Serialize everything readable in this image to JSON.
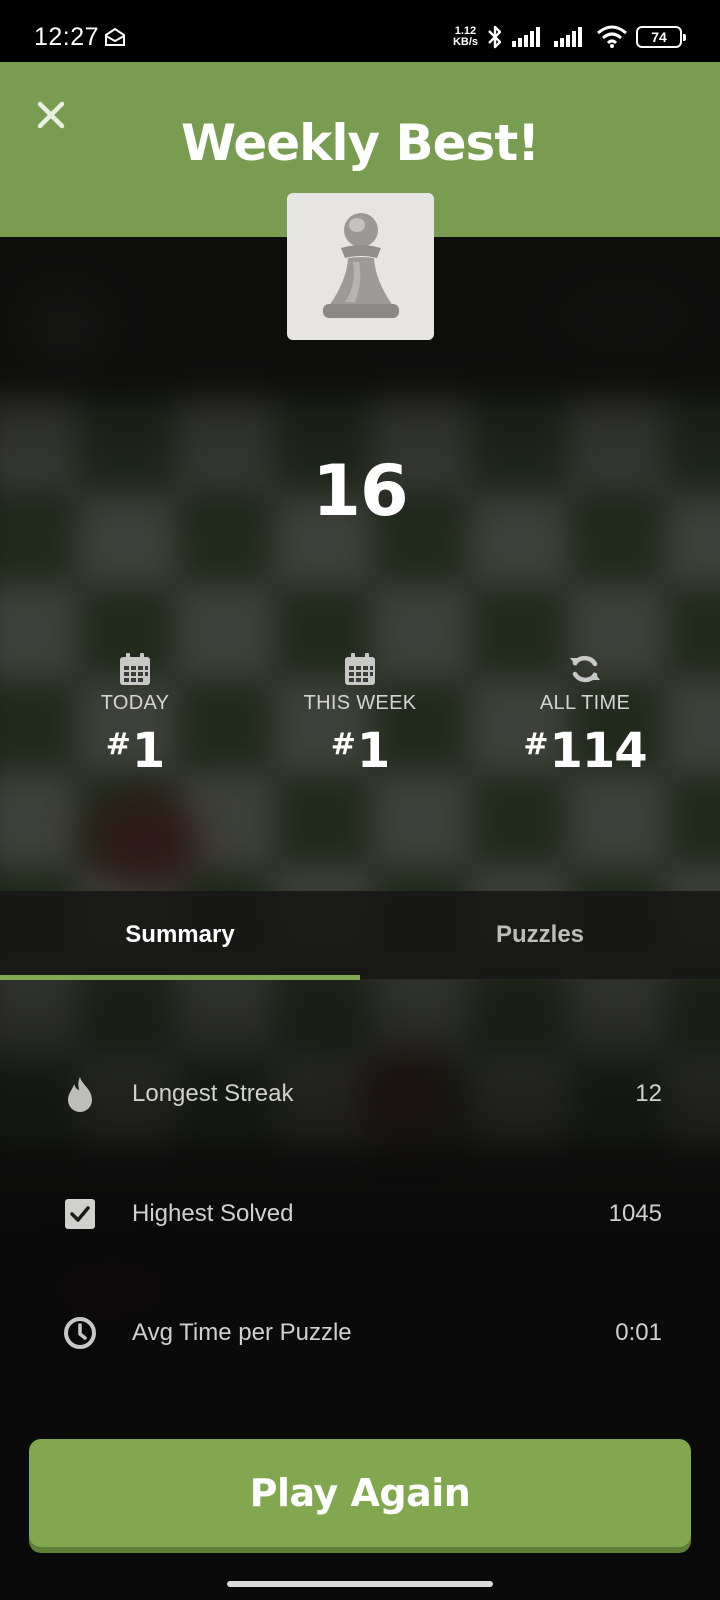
{
  "status_bar": {
    "time": "12:27",
    "net_speed_value": "1.12",
    "net_speed_unit": "KB/s",
    "battery": "74"
  },
  "header": {
    "title": "Weekly Best!"
  },
  "result": {
    "score": "16"
  },
  "ranks": [
    {
      "icon": "calendar-icon",
      "label": "TODAY",
      "hash": "#",
      "value": "1"
    },
    {
      "icon": "calendar-icon",
      "label": "THIS WEEK",
      "hash": "#",
      "value": "1"
    },
    {
      "icon": "refresh-icon",
      "label": "ALL TIME",
      "hash": "#",
      "value": "114"
    }
  ],
  "tabs": {
    "summary": "Summary",
    "puzzles": "Puzzles",
    "active": "Summary"
  },
  "stats": [
    {
      "icon": "flame-icon",
      "label": "Longest Streak",
      "value": "12"
    },
    {
      "icon": "checkbox-icon",
      "label": "Highest Solved",
      "value": "1045"
    },
    {
      "icon": "clock-icon",
      "label": "Avg Time per Puzzle",
      "value": "0:01"
    }
  ],
  "actions": {
    "play_again": "Play Again"
  },
  "colors": {
    "accent_green": "#789d50",
    "button_green": "#81a84f",
    "tab_underline": "#80a855",
    "background": "#0d0d0c"
  }
}
